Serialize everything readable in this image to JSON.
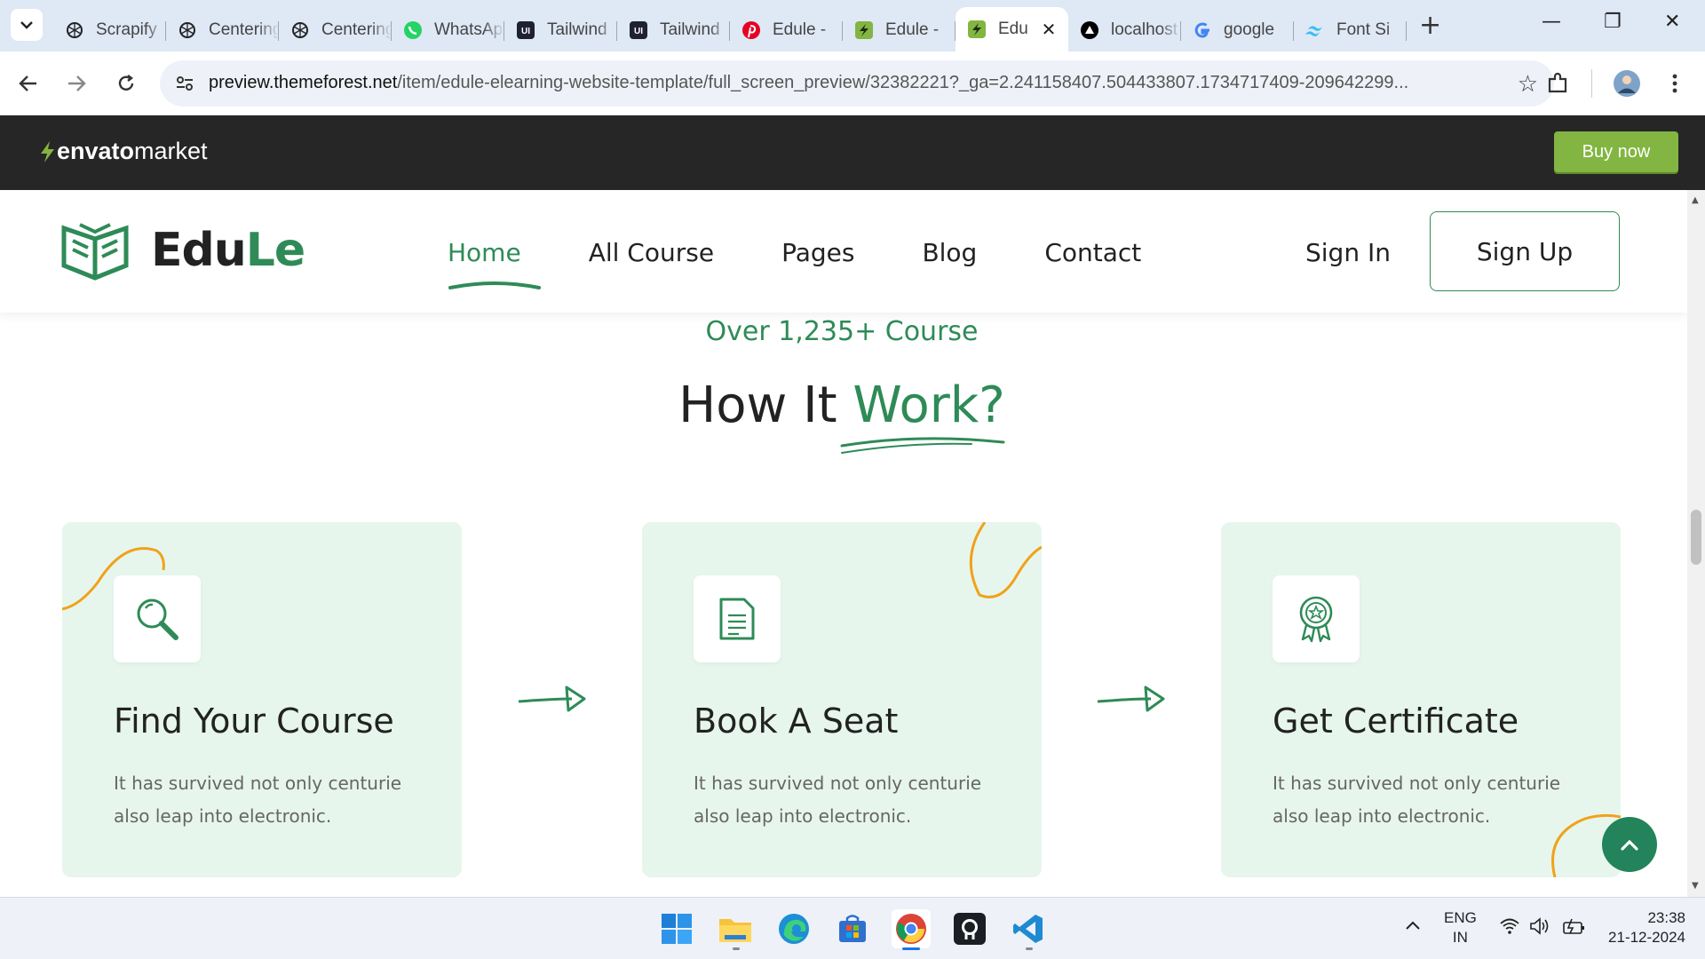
{
  "browser": {
    "tabs": [
      {
        "title": "Scrapify",
        "favicon": "openai-icon"
      },
      {
        "title": "Centering",
        "favicon": "openai-icon"
      },
      {
        "title": "Centering",
        "favicon": "openai-icon"
      },
      {
        "title": "WhatsApp",
        "favicon": "whatsapp-icon"
      },
      {
        "title": "Tailwind",
        "favicon": "ui-icon"
      },
      {
        "title": "Tailwind",
        "favicon": "ui-icon"
      },
      {
        "title": "Edule -",
        "favicon": "pinterest-icon"
      },
      {
        "title": "Edule -",
        "favicon": "envato-icon"
      },
      {
        "title": "Edu",
        "favicon": "envato-icon",
        "active": true
      },
      {
        "title": "localhost",
        "favicon": "vercel-icon"
      },
      {
        "title": "google",
        "favicon": "google-icon"
      },
      {
        "title": "Font Si",
        "favicon": "tailwind-icon"
      }
    ],
    "new_tab_label": "+",
    "close_label": "✕",
    "url_host": "preview.themeforest.net",
    "url_path": "/item/edule-elearning-website-template/full_screen_preview/32382221?_ga=2.241158407.504433807.1734717409-209642299..."
  },
  "envato": {
    "logo_bold": "envato",
    "logo_light": "market",
    "buy_label": "Buy now",
    "accent": "#82b541"
  },
  "site": {
    "brand_main": "Edu",
    "brand_accent": "Le",
    "nav": [
      "Home",
      "All Course",
      "Pages",
      "Blog",
      "Contact"
    ],
    "signin_label": "Sign In",
    "signup_label": "Sign Up",
    "accent": "#2e8b57"
  },
  "section": {
    "subheading": "Over 1,235+ Course",
    "heading_plain": "How It ",
    "heading_accent": "Work?",
    "cards": [
      {
        "title": "Find Your Course",
        "text": "It has survived not only centurie also leap into electronic.",
        "icon": "search-icon"
      },
      {
        "title": "Book A Seat",
        "text": "It has survived not only centurie also leap into electronic.",
        "icon": "document-icon"
      },
      {
        "title": "Get Certificate",
        "text": "It has survived not only centurie also leap into electronic.",
        "icon": "certificate-icon"
      }
    ]
  },
  "taskbar": {
    "lang_top": "ENG",
    "lang_bottom": "IN",
    "time": "23:38",
    "date": "21-12-2024"
  }
}
